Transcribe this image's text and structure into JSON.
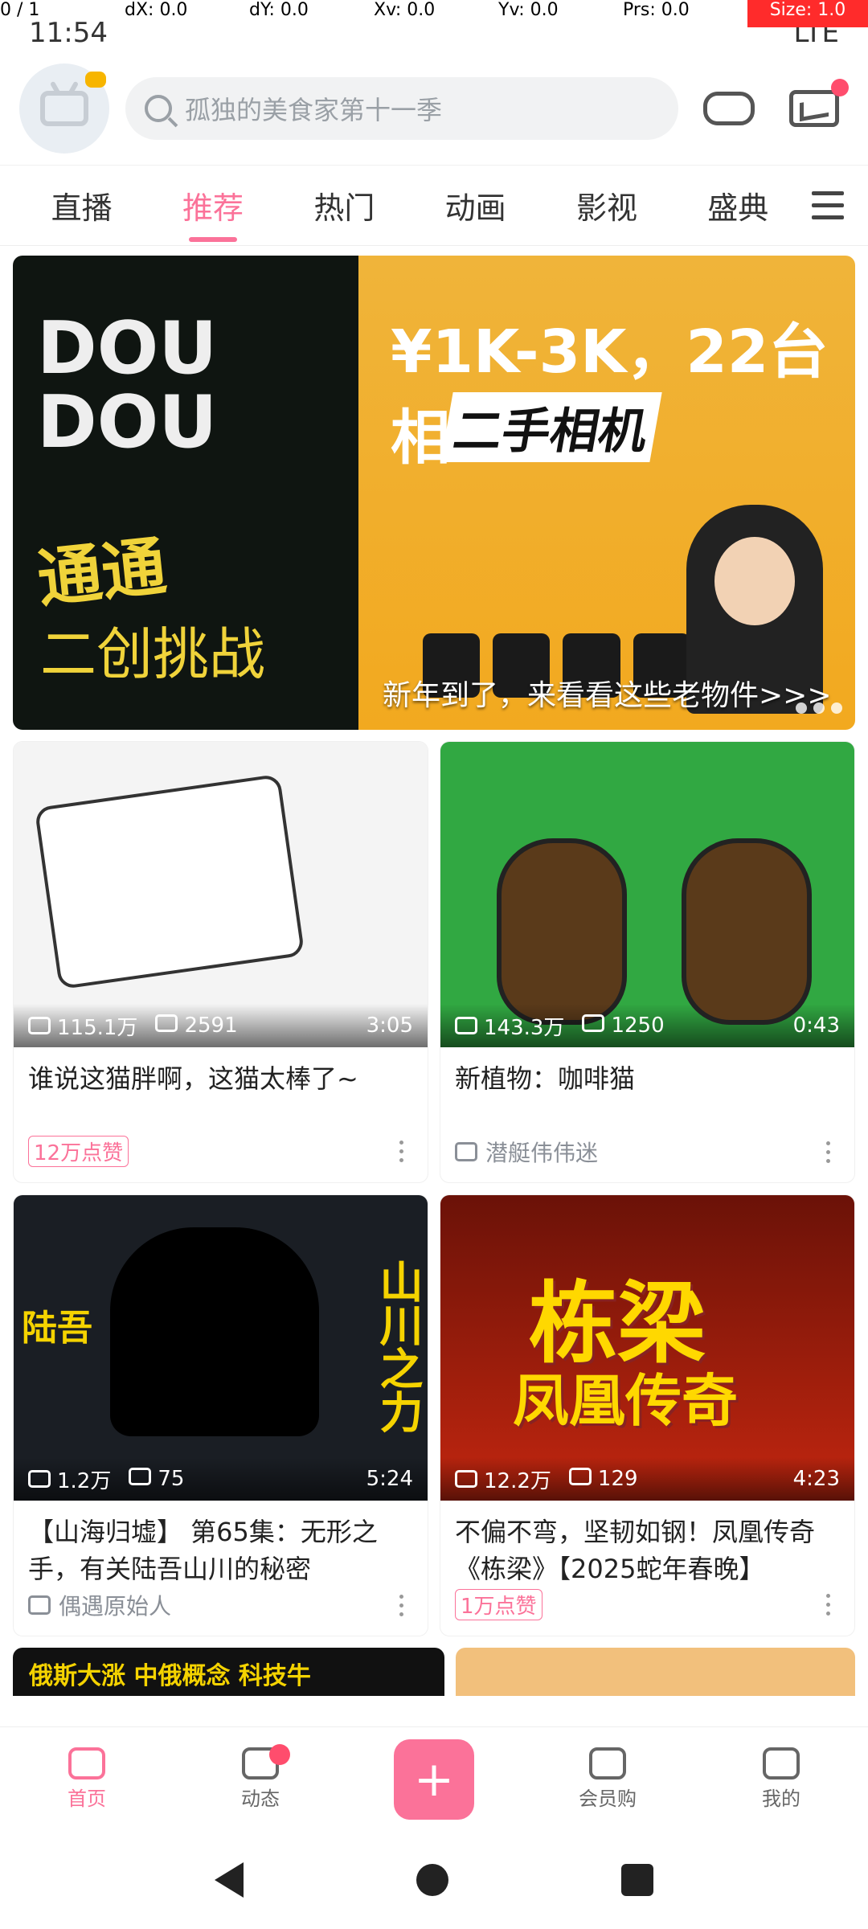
{
  "status_bar": {
    "time": "11:54",
    "debug": {
      "p": "0 / 1",
      "dx": "dX: 0.0",
      "dy": "dY: 0.0",
      "xv": "Xv: 0.0",
      "yv": "Yv: 0.0",
      "prs": "Prs: 0.0",
      "size": "Size: 1.0"
    },
    "network": "LTE"
  },
  "header": {
    "search_placeholder": "孤独的美食家第十一季"
  },
  "tabs": [
    {
      "label": "直播"
    },
    {
      "label": "推荐",
      "active": true
    },
    {
      "label": "热门"
    },
    {
      "label": "动画"
    },
    {
      "label": "影视"
    },
    {
      "label": "盛典"
    }
  ],
  "banner": {
    "left_text_1": "DOU DOU",
    "left_text_2": "通通",
    "left_text_3": "二创挑战",
    "right_text_1": "¥1K-3K，22台相",
    "right_text_2": "二手相机",
    "caption": "新年到了，来看看这些老物件>>>"
  },
  "cards": [
    {
      "views": "115.1万",
      "comments": "2591",
      "duration": "3:05",
      "title": "谁说这猫胖啊，这猫太棒了~",
      "like": "12万点赞",
      "author": "",
      "theme": "cat"
    },
    {
      "views": "143.3万",
      "comments": "1250",
      "duration": "0:43",
      "title": "新植物：咖啡猫",
      "author": "潜艇伟伟迷",
      "theme": "plant"
    },
    {
      "views": "1.2万",
      "comments": "75",
      "duration": "5:24",
      "title": "【山海归墟】 第65集：无形之手，有关陆吾山川的秘密",
      "author": "偶遇原始人",
      "theme": "shan",
      "thumb_l1": "陆吾",
      "thumb_l2": "山川之力"
    },
    {
      "views": "12.2万",
      "comments": "129",
      "duration": "4:23",
      "title": "不偏不弯，坚韧如钢！凤凰传奇《栋梁》【2025蛇年春晚】",
      "like": "1万点赞",
      "theme": "liang",
      "thumb_t1": "栋梁",
      "thumb_t2": "凤凰传奇"
    }
  ],
  "peek_left": "俄斯大涨 中俄概念 科技牛",
  "bottom_nav": [
    {
      "label": "首页",
      "active": true
    },
    {
      "label": "动态"
    },
    {
      "label": "+"
    },
    {
      "label": "会员购"
    },
    {
      "label": "我的"
    }
  ],
  "colors": {
    "accent": "#fb7299"
  }
}
